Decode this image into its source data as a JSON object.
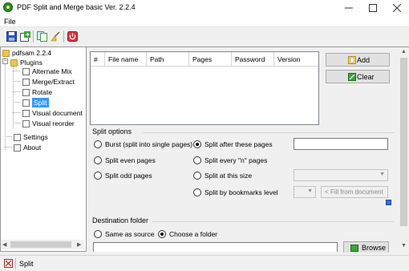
{
  "window": {
    "title": "PDF Split and Merge basic Ver. 2.2.4"
  },
  "menu": {
    "file": "File"
  },
  "tree": {
    "root": "pdfsam 2.2.4",
    "plugins": "Plugins",
    "items": [
      "Alternate Mix",
      "Merge/Extract",
      "Rotate",
      "Split",
      "Visual document",
      "Visual reorder"
    ],
    "settings": "Settings",
    "about": "About",
    "selected": "Split"
  },
  "table": {
    "columns": [
      "#",
      "File name",
      "Path",
      "Pages",
      "Password",
      "Version"
    ]
  },
  "buttons": {
    "add": "Add",
    "clear": "Clear",
    "browse": "Browse"
  },
  "split_options": {
    "title": "Split options",
    "left": [
      "Burst (split into single pages)",
      "Split even pages",
      "Split odd pages"
    ],
    "right": [
      "Split after these pages",
      "Split every \"n\" pages",
      "Split at this size",
      "Split by bookmarks level"
    ],
    "selected": "Split after these pages",
    "fill_from_document": "< Fill from document"
  },
  "destination": {
    "title": "Destination folder",
    "options": [
      "Same as source",
      "Choose a folder"
    ],
    "selected": "Choose a folder"
  },
  "status": {
    "text": "Split"
  },
  "colors": {
    "selection": "#3399ff",
    "accent_green": "#2e8b2e",
    "folder": "#e9c456"
  }
}
